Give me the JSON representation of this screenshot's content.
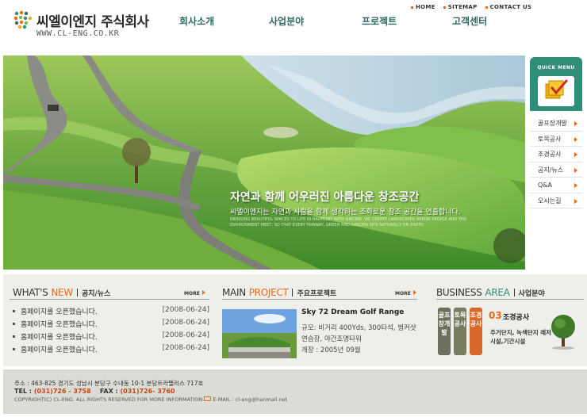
{
  "brand": {
    "name": "씨엘이엔지 주식회사",
    "url": "WWW.CL-ENG.CO.KR"
  },
  "util_nav": [
    "HOME",
    "SITEMAP",
    "CONTACT US"
  ],
  "gnb": [
    "회사소개",
    "사업분야",
    "프로젝트",
    "고객센터"
  ],
  "hero": {
    "title": "자연과 함께 어우러진 아름다운 창조공간",
    "subtitle": "씨엘이엔지는 자연과 사람을 함께 생각하는 조화로운 창조 공간을 연출합니다.",
    "english": "BRINGING BEAUTIFUL SPACES TO LIFE IN HARMONY WITH NATURE. WE CREATE LANDSCAPES WHERE PEOPLE AND THE ENVIRONMENT MEET, SO THAT EVERY FAIRWAY, GREEN AND GARDEN SITS NATURALLY ON EARTH"
  },
  "quick_menu": {
    "title": "QUICK MENU",
    "items": [
      "골프장개발",
      "토목공사",
      "조경공사",
      "공지/뉴스",
      "Q&A",
      "오시는길"
    ]
  },
  "news": {
    "title_en_a": "WHAT'S",
    "title_en_b": "NEW",
    "title_kr": "공지/뉴스",
    "more": "MORE",
    "items": [
      {
        "title": "홈페이지를 오픈했습니다.",
        "date": "[2008-06-24]"
      },
      {
        "title": "홈페이지를 오픈했습니다.",
        "date": "[2008-06-24]"
      },
      {
        "title": "홈페이지를 오픈했습니다.",
        "date": "[2008-06-24]"
      },
      {
        "title": "홈페이지를 오픈했습니다.",
        "date": "[2008-06-24]"
      }
    ]
  },
  "project": {
    "title_en_a": "MAIN",
    "title_en_b": "PROJECT",
    "title_kr": "주요프로젝트",
    "more": "MORE",
    "name": "Sky 72 Dream Golf Range",
    "desc": "규모: 비거리 400Yds, 300타석, 벙커샷 연습장, 야간조명타워",
    "opened": "개장 : 2005년 09월"
  },
  "business": {
    "title_en_a": "BUSINESS",
    "title_en_b": "AREA",
    "title_kr": "사업분야",
    "pills": [
      "골프장개발",
      "토목공사",
      "조경공사"
    ],
    "num": "03",
    "name": "조경공사",
    "desc": "주거단지, 녹색단지 레저시설,기간시설"
  },
  "footer": {
    "address": "주소 : 463-825  경기도 성남시 분당구 수내동 10-1 분당트라팰리스 717호",
    "tel_label": "TEL :",
    "tel": "(031)726 - 3758",
    "fax_label": "FAX :",
    "fax": "(031)726- 3760",
    "copyright": "COPYRIGHT(C) CL-ENG. ALL RIGHTS RESERVED FOR MORE INFORMATION",
    "email": "E-MAIL : cl-eng@hanmail.net"
  },
  "colors": {
    "accent": "#e96a10",
    "nav": "#2c6a62",
    "quick": "#2f8d78",
    "pill1": "#6d6f5c",
    "pill2": "#7a7c62",
    "pill3": "#d9692a"
  }
}
